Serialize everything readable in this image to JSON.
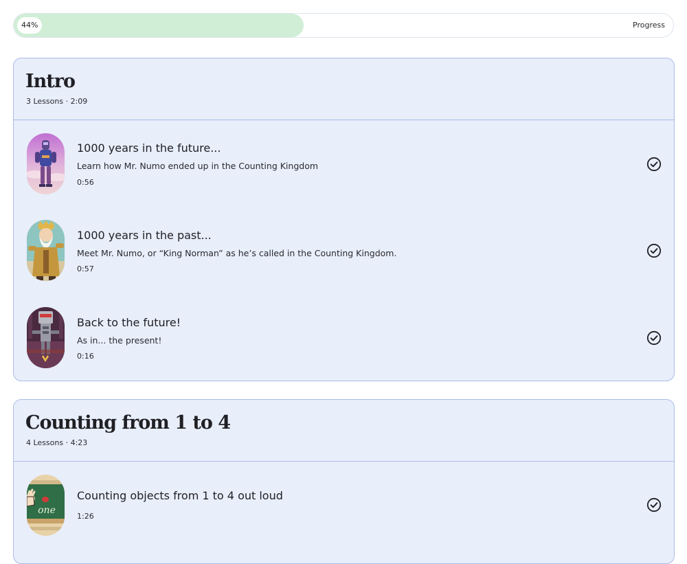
{
  "progress": {
    "percent_label": "44%",
    "fraction": 0.44,
    "label": "Progress"
  },
  "sections": [
    {
      "title": "Intro",
      "meta": "3 Lessons · 2:09",
      "lessons": [
        {
          "title": "1000 years in the future...",
          "description": "Learn how Mr. Numo ended up in the Counting Kingdom",
          "duration": "0:56",
          "completed": true,
          "thumbnail": "future-robot-thumbnail"
        },
        {
          "title": "1000 years in the past...",
          "description": "Meet Mr. Numo, or “King Norman” as he’s called in the Counting Kingdom.",
          "duration": "0:57",
          "completed": true,
          "thumbnail": "king-norman-thumbnail"
        },
        {
          "title": "Back to the future!",
          "description": "As in... the present!",
          "duration": "0:16",
          "completed": true,
          "thumbnail": "present-robot-thumbnail"
        }
      ]
    },
    {
      "title": "Counting from 1 to 4",
      "meta": "4 Lessons · 4:23",
      "lessons": [
        {
          "title": "Counting objects from 1 to 4 out loud",
          "description": "",
          "duration": "1:26",
          "completed": true,
          "thumbnail": "chalkboard-one-thumbnail",
          "thumb_text": "one"
        }
      ]
    }
  ],
  "colors": {
    "progress_fill": "#d0eed5",
    "section_bg": "#e8eefa",
    "section_border": "#a9bde6",
    "text": "#1f1f24"
  },
  "icons": {
    "completed": "check-circle-icon"
  }
}
